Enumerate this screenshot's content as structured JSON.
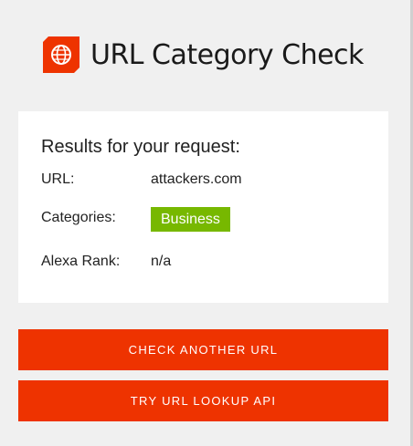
{
  "header": {
    "title": "URL Category Check",
    "logo_icon": "globe-shield-icon",
    "brand_color": "#ee3300"
  },
  "results": {
    "heading": "Results for your request:",
    "url_label": "URL:",
    "url_value": "attackers.com",
    "categories_label": "Categories:",
    "category_badge": "Business",
    "category_color": "#77b800",
    "alexa_label": "Alexa Rank:",
    "alexa_value": "n/a"
  },
  "actions": {
    "check_another_label": "CHECK ANOTHER URL",
    "lookup_api_label": "TRY URL LOOKUP API"
  }
}
